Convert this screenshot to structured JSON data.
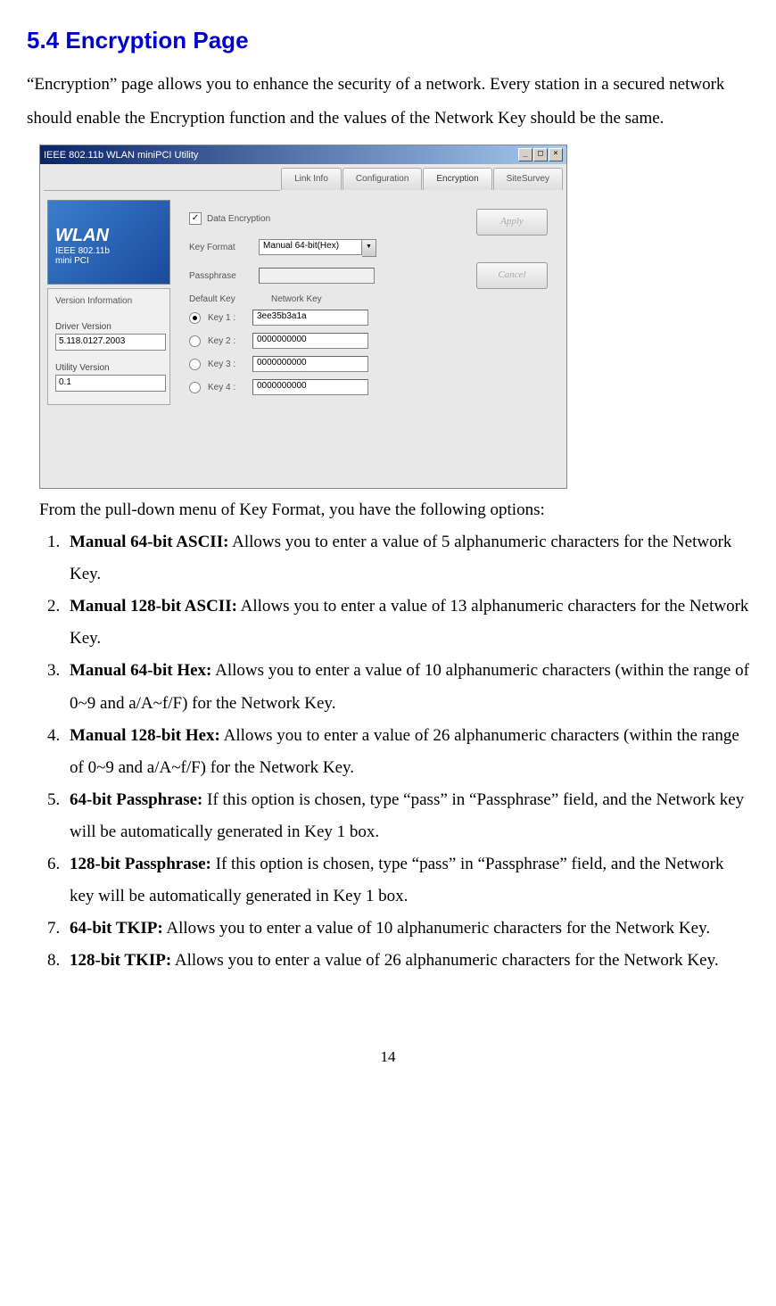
{
  "heading": "5.4 Encryption Page",
  "intro": "“Encryption” page allows you to enhance the security of a network. Every station in a secured network should enable the Encryption function and the values of the Network Key should be the same.",
  "post_screenshot": "From the pull-down menu of Key Format, you have the following options:",
  "options": [
    {
      "name": "Manual 64-bit ASCII:",
      "desc": " Allows you to enter a value of 5 alphanumeric characters for the Network Key."
    },
    {
      "name": "Manual 128-bit ASCII:",
      "desc": " Allows you to enter a value of 13 alphanumeric characters for the Network Key."
    },
    {
      "name": "Manual 64-bit Hex:",
      "desc": " Allows you to enter a value of 10 alphanumeric characters (within the range of 0~9 and a/A~f/F) for the Network Key."
    },
    {
      "name": "Manual 128-bit Hex:",
      "desc": " Allows you to enter a value of 26 alphanumeric characters (within the range of 0~9 and a/A~f/F) for the Network Key."
    },
    {
      "name": "64-bit Passphrase:",
      "desc": " If this option is chosen, type “pass” in “Passphrase” field, and the Network key will be automatically generated in Key 1 box."
    },
    {
      "name": "128-bit Passphrase:",
      "desc": " If this option is chosen, type “pass” in “Passphrase” field, and the Network key will be automatically generated in Key 1 box."
    },
    {
      "name": "64-bit TKIP:",
      "desc": " Allows you to enter a value of 10 alphanumeric characters for the Network Key."
    },
    {
      "name": "128-bit TKIP:",
      "desc": " Allows you to enter a value of 26 alphanumeric characters for the Network Key."
    }
  ],
  "page_number": "14",
  "app": {
    "title": "IEEE 802.11b WLAN miniPCI Utility",
    "tabs": {
      "link_info": "Link Info",
      "configuration": "Configuration",
      "encryption": "Encryption",
      "site_survey": "SiteSurvey"
    },
    "sidebar": {
      "wlan": "WLAN",
      "ieee": "IEEE 802.11b",
      "minipci": "mini PCI",
      "version_info": "Version Information",
      "driver_label": "Driver Version",
      "driver_value": "5.118.0127.2003",
      "utility_label": "Utility Version",
      "utility_value": "0.1"
    },
    "settings": {
      "data_encryption": "Data Encryption",
      "key_format": "Key Format",
      "key_format_value": "Manual 64-bit(Hex)",
      "passphrase": "Passphrase",
      "default_key": "Default Key",
      "network_key": "Network Key",
      "key1_label": "Key 1 :",
      "key1_value": "3ee35b3a1a",
      "key2_label": "Key 2 :",
      "key2_value": "0000000000",
      "key3_label": "Key 3 :",
      "key3_value": "0000000000",
      "key4_label": "Key 4 :",
      "key4_value": "0000000000"
    },
    "buttons": {
      "apply": "Apply",
      "cancel": "Cancel"
    },
    "win_buttons": {
      "min": "_",
      "max": "□",
      "close": "×"
    }
  }
}
